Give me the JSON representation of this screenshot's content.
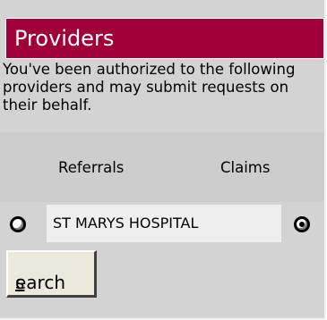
{
  "header": {
    "title": "Providers"
  },
  "description": "You've been authorized to the following providers and may submit requests on their behalf.",
  "columns": {
    "referrals": "Referrals",
    "claims": "Claims"
  },
  "providers": [
    {
      "name": "ST MARYS HOSPITAL",
      "referrals_selected": false,
      "claims_selected": true
    }
  ],
  "search_button": {
    "accesskey_letter": "s",
    "rest": "earch"
  }
}
